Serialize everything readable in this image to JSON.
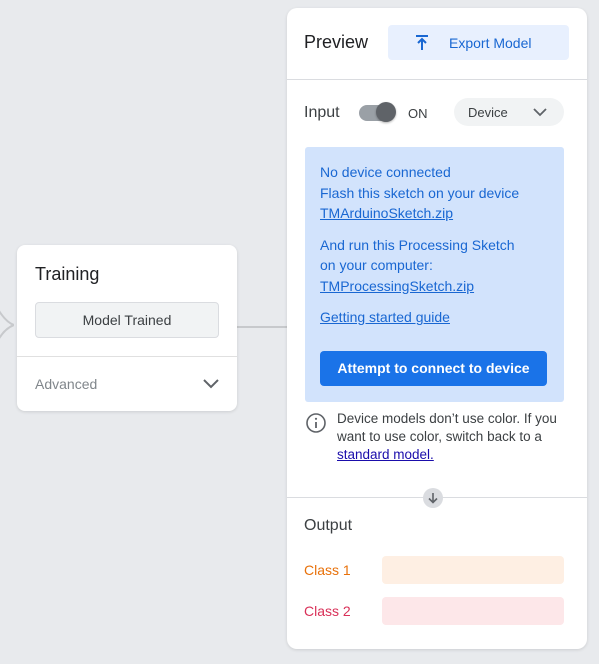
{
  "training": {
    "title": "Training",
    "status_button": "Model Trained",
    "advanced_label": "Advanced"
  },
  "preview": {
    "title": "Preview",
    "export_button": "Export Model",
    "input_label": "Input",
    "toggle_state": "ON",
    "source_select": "Device",
    "device_box": {
      "line1": "No device connected",
      "line2": "Flash this sketch on your device",
      "arduino_link": "TMArduinoSketch.zip",
      "line3": "And run this Processing Sketch",
      "line4": "on your computer:",
      "processing_link": "TMProcessingSketch.zip",
      "guide_link": "Getting started guide",
      "connect_button": "Attempt to connect to device"
    },
    "info": {
      "text": "Device models don’t use color. If you want to use color, switch back to a ",
      "link": "standard model."
    },
    "output": {
      "title": "Output",
      "classes": [
        {
          "label": "Class 1",
          "color": "#e8710a",
          "bar_color": "#feefe3"
        },
        {
          "label": "Class 2",
          "color": "#d93058",
          "bar_color": "#fde7e9"
        }
      ]
    }
  }
}
